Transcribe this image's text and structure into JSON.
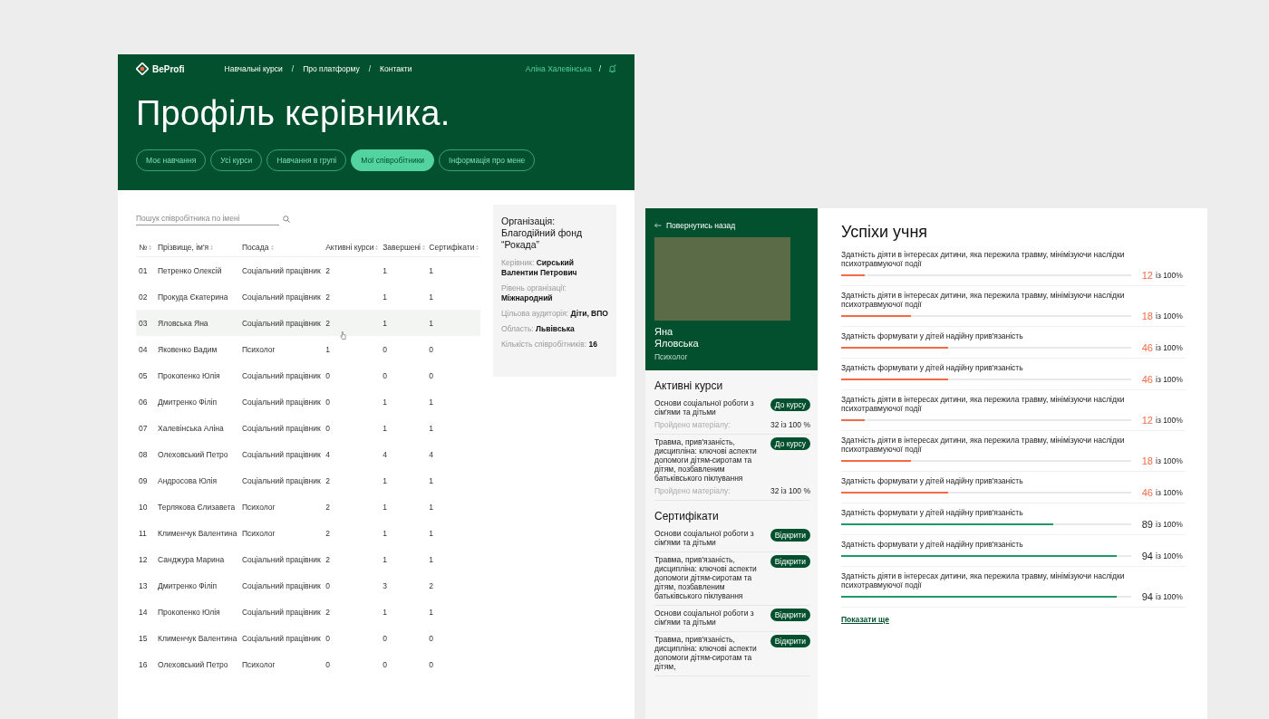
{
  "manager_page": {
    "logo": "BeProfi",
    "nav": [
      {
        "label": "Навчальні курси"
      },
      {
        "label": "Про платформу"
      },
      {
        "label": "Контакти"
      }
    ],
    "nav_separator": "/",
    "user_name": "Аліна Халевінська",
    "user_separator": "/",
    "title": "Профіль керівника.",
    "tabs": [
      {
        "label": "Моє навчання",
        "selected": false
      },
      {
        "label": "Усі курси",
        "selected": false
      },
      {
        "label": "Навчання в групі",
        "selected": false
      },
      {
        "label": "Мої співробітники",
        "selected": true
      },
      {
        "label": "Інформація про мене",
        "selected": false
      }
    ],
    "search": {
      "placeholder": "Пошук співробітника по імені"
    },
    "table": {
      "columns": [
        "№",
        "Прізвище, ім'я",
        "Посада",
        "Активні курси",
        "Завершені",
        "Сертифікати"
      ],
      "rows": [
        {
          "cells": [
            "01",
            "Петренко Олексій",
            "Соціальний працівник",
            "2",
            "1",
            "1"
          ],
          "selected": false
        },
        {
          "cells": [
            "02",
            "Прокуда Єкатерина",
            "Соціальний працівник",
            "2",
            "1",
            "1"
          ],
          "selected": false
        },
        {
          "cells": [
            "03",
            "Яловська Яна",
            "Соціальний працівник",
            "2",
            "1",
            "1"
          ],
          "selected": true
        },
        {
          "cells": [
            "04",
            "Яковенко Вадим",
            "Психолог",
            "1",
            "0",
            "0"
          ],
          "selected": false
        },
        {
          "cells": [
            "05",
            "Прокопенко Юлія",
            "Соціальний працівник",
            "0",
            "0",
            "0"
          ],
          "selected": false
        },
        {
          "cells": [
            "06",
            "Дмитренко Філіп",
            "Соціальний працівник",
            "0",
            "1",
            "1"
          ],
          "selected": false
        },
        {
          "cells": [
            "07",
            "Халевінська Аліна",
            "Соціальний працівник",
            "0",
            "1",
            "1"
          ],
          "selected": false
        },
        {
          "cells": [
            "08",
            "Олеховський Петро",
            "Соціальний працівник",
            "4",
            "4",
            "4"
          ],
          "selected": false
        },
        {
          "cells": [
            "09",
            "Андросова Юлія",
            "Соціальний працівник",
            "2",
            "1",
            "1"
          ],
          "selected": false
        },
        {
          "cells": [
            "10",
            "Терлякова Єлизавета",
            "Психолог",
            "2",
            "1",
            "1"
          ],
          "selected": false
        },
        {
          "cells": [
            "11",
            "Клименчук Валентина",
            "Психолог",
            "2",
            "1",
            "1"
          ],
          "selected": false
        },
        {
          "cells": [
            "12",
            "Санджура Марина",
            "Соціальний працівник",
            "2",
            "1",
            "1"
          ],
          "selected": false
        },
        {
          "cells": [
            "13",
            "Дмитренко Філіп",
            "Соціальний працівник",
            "0",
            "3",
            "2"
          ],
          "selected": false
        },
        {
          "cells": [
            "14",
            "Прокопенко Юлія",
            "Соціальний працівник",
            "2",
            "1",
            "1"
          ],
          "selected": false
        },
        {
          "cells": [
            "15",
            "Клименчук Валентина",
            "Соціальний працівник",
            "0",
            "0",
            "0"
          ],
          "selected": false
        },
        {
          "cells": [
            "16",
            "Олеховський Петро",
            "Психолог",
            "0",
            "0",
            "0"
          ],
          "selected": false
        }
      ]
    },
    "organization": {
      "title": "Організація: Благодійний фонд “Рокада”",
      "fields": [
        {
          "label": "Керівник:",
          "value": "Сирський Валентин Петрович"
        },
        {
          "label": "Рівень організації:",
          "value": "Міжнародний"
        },
        {
          "label": "Цільова аудиторія:",
          "value": "Діти, ВПО"
        },
        {
          "label": "Область:",
          "value": "Львівська"
        },
        {
          "label": "Кількість співробітників:",
          "value": "16"
        }
      ]
    }
  },
  "student_page": {
    "back_link": "Повернутись назад",
    "student_name": "Яна Яловська",
    "student_role": "Психолог",
    "active_courses": {
      "title": "Активні курси",
      "items": [
        {
          "name": "Основи соціальної роботи з сім'ями та дітьми",
          "button": "До курсу",
          "progress_label": "Пройдено матеріалу:",
          "progress": "32 із 100 %"
        },
        {
          "name": "Травма, прив'язаність, дисципліна: ключові аспекти допомоги дітям-сиротам та дітям, позбавленим батьківського піклування",
          "button": "До курсу",
          "progress_label": "Пройдено матеріалу:",
          "progress": "32 із 100 %"
        }
      ]
    },
    "certificates": {
      "title": "Сертифікати",
      "items": [
        {
          "name": "Основи соціальної роботи з сім'ями та дітьми",
          "button": "Відкрити"
        },
        {
          "name": "Травма, прив'язаність, дисципліна: ключові аспекти допомоги дітям-сиротам та дітям, позбавленим батьківського піклування",
          "button": "Відкрити"
        },
        {
          "name": "Основи соціальної роботи з сім'ями та дітьми",
          "button": "Відкрити"
        },
        {
          "name": "Травма, прив'язаність, дисципліна: ключові аспекти допомоги дітям-сиротам та дітям,",
          "button": "Відкрити"
        }
      ]
    },
    "progress_title": "Успіхи учня",
    "skills": [
      {
        "name": "Здатність діяти в інтересах дитини, яка пережила травму, мінімізуючи наслідки психотравмуючої події",
        "score": "12",
        "of": "із 100%",
        "level": 0.08,
        "color": "#f26b45"
      },
      {
        "name": "Здатність діяти в інтересах дитини, яка пережила травму, мінімізуючи наслідки психотравмуючої події",
        "score": "18",
        "of": "із 100%",
        "level": 0.24,
        "color": "#f26b45"
      },
      {
        "name": "Здатність формувати у дітей надійну прив'язаність",
        "score": "46",
        "of": "із 100%",
        "level": 0.37,
        "color": "#f26b45"
      },
      {
        "name": "Здатність формувати у дітей надійну прив'язаність",
        "score": "46",
        "of": "із 100%",
        "level": 0.37,
        "color": "#f26b45"
      },
      {
        "name": "Здатність діяти в інтересах дитини, яка пережила травму, мінімізуючи наслідки психотравмуючої події",
        "score": "12",
        "of": "із 100%",
        "level": 0.08,
        "color": "#f26b45"
      },
      {
        "name": "Здатність діяти в інтересах дитини, яка пережила травму, мінімізуючи наслідки психотравмуючої події",
        "score": "18",
        "of": "із 100%",
        "level": 0.24,
        "color": "#f26b45"
      },
      {
        "name": "Здатність формувати у дітей надійну прив'язаність",
        "score": "46",
        "of": "із 100%",
        "level": 0.37,
        "color": "#f26b45"
      },
      {
        "name": "Здатність формувати у дітей надійну прив'язаність",
        "score": "89",
        "of": "із 100%",
        "level": 0.73,
        "color": "#1f9a62"
      },
      {
        "name": "Здатність формувати у дітей надійну прив'язаність",
        "score": "94",
        "of": "із 100%",
        "level": 0.95,
        "color": "#1f9a62"
      },
      {
        "name": "Здатність діяти в інтересах дитини, яка пережила травму, мінімізуючи наслідки психотравмуючої події",
        "score": "94",
        "of": "із 100%",
        "level": 0.95,
        "color": "#1f9a62"
      }
    ],
    "show_more": "Показати ще"
  }
}
